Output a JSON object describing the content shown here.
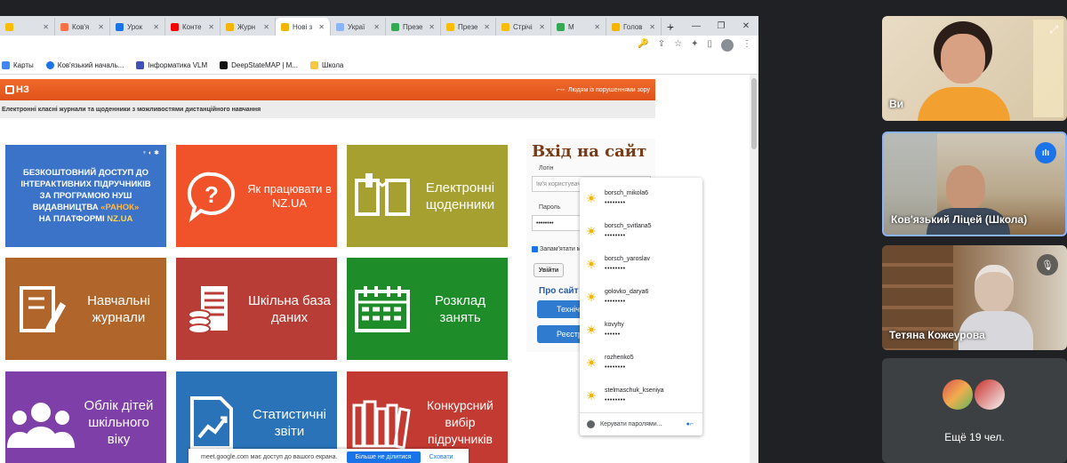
{
  "browser": {
    "tabs": [
      {
        "label": "",
        "color": "#fbbc04"
      },
      {
        "label": "Ков'я",
        "color": "#ff7043"
      },
      {
        "label": "Урок",
        "color": "#1a73e8"
      },
      {
        "label": "Конте",
        "color": "#ff0000"
      },
      {
        "label": "Журн",
        "color": "#f4b400"
      },
      {
        "label": "Нові з",
        "color": "#f4b400",
        "active": true
      },
      {
        "label": "Украї",
        "color": "#8ab4f8"
      },
      {
        "label": "Презе",
        "color": "#34a853"
      },
      {
        "label": "Презе",
        "color": "#fbbc04"
      },
      {
        "label": "Стрічі",
        "color": "#fbbc04"
      },
      {
        "label": "M",
        "color": "#34a853"
      },
      {
        "label": "Голов",
        "color": "#f4b400"
      }
    ],
    "new_tab": "+",
    "window_controls": [
      "⌄",
      "—",
      "❐",
      "✕"
    ],
    "toolbar_icons": [
      "🔑",
      "⇪",
      "☆",
      "✦",
      "▯"
    ],
    "menu_icon": "⋮",
    "bookmarks": [
      {
        "label": "Карты",
        "color": "#4285f4"
      },
      {
        "label": "Ков'язький началь...",
        "color": "#1a73e8"
      },
      {
        "label": "Інформатика VLM",
        "color": "#3f51b5"
      },
      {
        "label": "DeepStateMAP | М...",
        "color": "#111111"
      },
      {
        "label": "Школа",
        "color": "#f9c642"
      }
    ]
  },
  "nz": {
    "logo": "НЗ",
    "vision_link": "Людям із порушеннями зору",
    "subheader": "Електронні класні журнали та щоденники з можливостями дистанційного навчання",
    "promo": {
      "line1": "БЕЗКОШТОВНИЙ ДОСТУП ДО",
      "line2": "ІНТЕРАКТИВНИХ ПІДРУЧНИКІВ",
      "line3": "ЗА ПРОГРАМОЮ НУШ",
      "line4_pre": "ВИДАВНИЦТВА ",
      "line4_hl": "«РАНОК»",
      "line5_pre": "НА ПЛАТФОРМІ ",
      "line5_hl": "NZ.UA"
    },
    "tiles": {
      "how": "Як працювати в NZ.UA",
      "diaries": "Електронні щоденники",
      "journals": "Навчальні журнали",
      "database": "Шкільна база даних",
      "schedule": "Розклад занять",
      "children": "Облік дітей шкільного віку",
      "stats": "Статистичні звіти",
      "textbooks": "Конкурсний вибір підручників"
    },
    "tile_colors": {
      "promo": "#3b73c8",
      "how": "#f0522a",
      "diaries": "#a6a030",
      "journals": "#b0652a",
      "database": "#b83d36",
      "schedule": "#1f8c2a",
      "children": "#7f3fa8",
      "stats": "#2a73b8",
      "textbooks": "#c23a32"
    }
  },
  "login": {
    "title": "Вхід на сайт",
    "login_label": "Логін",
    "login_placeholder": "Ім'я користувача або e-mail",
    "password_label": "Пароль",
    "password_value": "••••••••",
    "remember": "Запам'ятати м",
    "submit": "Увійти",
    "about": "Про сайт",
    "tech_button": "Технічн",
    "register_button": "Реєстр"
  },
  "password_popup": {
    "items": [
      {
        "user": "borsch_mikola6",
        "dots": "••••••••"
      },
      {
        "user": "borsch_svitlana5",
        "dots": "••••••••"
      },
      {
        "user": "borsch_yaroslav",
        "dots": "••••••••"
      },
      {
        "user": "golovko_darya6",
        "dots": "••••••••"
      },
      {
        "user": "kovyhy",
        "dots": "••••••"
      },
      {
        "user": "rozhenko5",
        "dots": "••••••••"
      },
      {
        "user": "stelmaschuk_kseniya",
        "dots": "••••••••"
      }
    ],
    "manage": "Керувати паролями..."
  },
  "share_bar": {
    "text": "meet.google.com має доступ до вашого екрана.",
    "stop": "Більше не ділитися",
    "hide": "Сховати"
  },
  "meet": {
    "participants": [
      {
        "name": "Ви"
      },
      {
        "name": "Ков'язький Ліцей (Школа)"
      },
      {
        "name": "Тетяна Кожеурова"
      }
    ],
    "more": "Ещё 19 чел."
  }
}
